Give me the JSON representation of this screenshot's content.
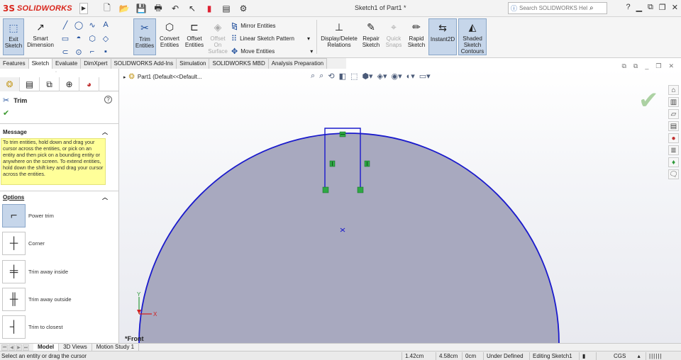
{
  "app": {
    "logo_mark": "3S",
    "logo_text": "SOLIDWORKS",
    "doc_title": "Sketch1 of Part1 *",
    "help_search_placeholder": "Search SOLIDWORKS Help",
    "help_label": "?"
  },
  "quick_access": [
    "new-icon",
    "open-icon",
    "save-icon",
    "print-icon",
    "undo-icon",
    "select-icon",
    "rebuild-icon",
    "file-properties-icon",
    "options-icon"
  ],
  "command_manager": {
    "exit_sketch": "Exit Sketch",
    "smart_dimension": "Smart Dimension",
    "trim_entities": "Trim Entities",
    "convert_entities": "Convert Entities",
    "offset_entities": "Offset Entities",
    "offset_on_surface": "Offset On Surface",
    "mirror_entities": "Mirror Entities",
    "linear_sketch_pattern": "Linear Sketch Pattern",
    "move_entities": "Move Entities",
    "display_delete_relations": "Display/Delete Relations",
    "repair_sketch": "Repair Sketch",
    "quick_snaps": "Quick Snaps",
    "rapid_sketch": "Rapid Sketch",
    "instant2d": "Instant2D",
    "shaded_sketch_contours": "Shaded Sketch Contours"
  },
  "tabs": [
    {
      "label": "Features",
      "active": false
    },
    {
      "label": "Sketch",
      "active": true
    },
    {
      "label": "Evaluate",
      "active": false
    },
    {
      "label": "DimXpert",
      "active": false
    },
    {
      "label": "SOLIDWORKS Add-Ins",
      "active": false
    },
    {
      "label": "Simulation",
      "active": false
    },
    {
      "label": "SOLIDWORKS MBD",
      "active": false
    },
    {
      "label": "Analysis Preparation",
      "active": false
    }
  ],
  "feature_tree": {
    "root_label": "Part1  (Default<<Default..."
  },
  "property_manager": {
    "title": "Trim",
    "message_header": "Message",
    "message_text": "To trim entities, hold down and drag your cursor across the entities, or pick on an entity and then pick on a bounding entity or anywhere on the screen.  To extend entities, hold down the shift key and drag your cursor across the entities.",
    "options_header": "Options",
    "options": [
      {
        "label": "Power trim",
        "selected": true
      },
      {
        "label": "Corner",
        "selected": false
      },
      {
        "label": "Trim away inside",
        "selected": false
      },
      {
        "label": "Trim away outside",
        "selected": false
      },
      {
        "label": "Trim to closest",
        "selected": false
      }
    ]
  },
  "graphics": {
    "view_label": "*Front",
    "axis_x": "X",
    "axis_y": "Y",
    "sketch_color": "#1a1acc",
    "fill_color": "#a9a9bf"
  },
  "bottom_tabs": [
    {
      "label": "Model",
      "active": true
    },
    {
      "label": "3D Views",
      "active": false
    },
    {
      "label": "Motion Study 1",
      "active": false
    }
  ],
  "status": {
    "message": "Select an entity or drag the cursor",
    "x": "1.42cm",
    "y": "4.58cm",
    "z": "0cm",
    "definition": "Under Defined",
    "editing": "Editing Sketch1",
    "units": "CGS"
  }
}
